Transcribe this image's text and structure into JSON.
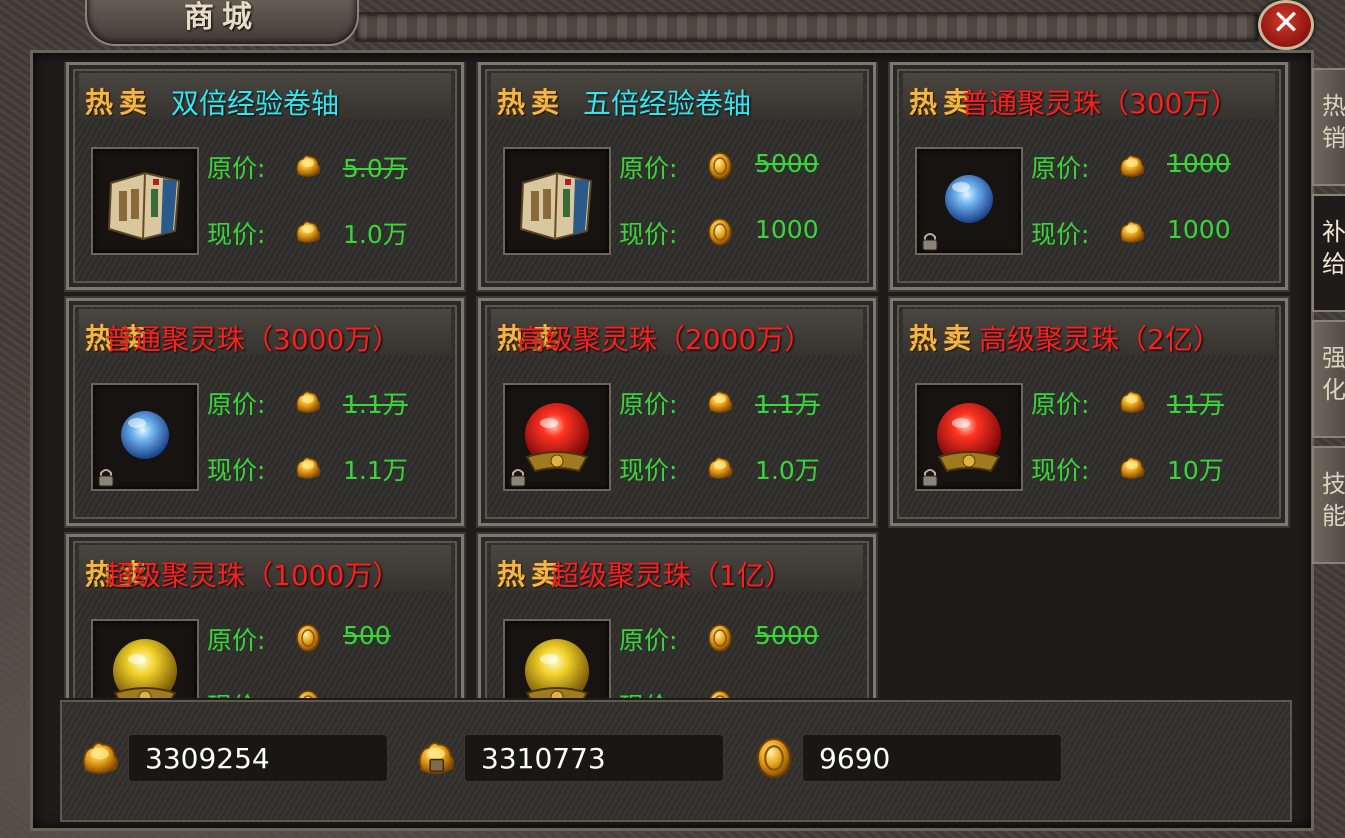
{
  "window": {
    "title": "商城",
    "close_label": "✕"
  },
  "side_tabs": [
    {
      "label": "热销",
      "active": false
    },
    {
      "label": "补给",
      "active": true
    },
    {
      "label": "强化",
      "active": false
    },
    {
      "label": "技能",
      "active": false
    }
  ],
  "labels": {
    "hot": "热卖",
    "original_price": "原价:",
    "current_price": "现价:"
  },
  "items": [
    {
      "name": "双倍经验卷轴",
      "name_color": "cyan",
      "icon": "scroll-book",
      "currency": "gold-ingot",
      "original": "5.0万",
      "current": "1.0万",
      "locked": false
    },
    {
      "name": "五倍经验卷轴",
      "name_color": "cyan",
      "icon": "scroll-book",
      "currency": "gold-coin",
      "original": "5000",
      "current": "1000",
      "locked": false
    },
    {
      "name": "普通聚灵珠（300万）",
      "name_color": "red",
      "icon": "blue-orb",
      "currency": "gold-ingot",
      "original": "1000",
      "current": "1000",
      "locked": true
    },
    {
      "name": "普通聚灵珠（3000万）",
      "name_color": "red",
      "icon": "blue-orb",
      "currency": "gold-ingot",
      "original": "1.1万",
      "current": "1.1万",
      "locked": true
    },
    {
      "name": "高级聚灵珠（2000万）",
      "name_color": "red",
      "icon": "red-orb",
      "currency": "gold-ingot",
      "original": "1.1万",
      "current": "1.0万",
      "locked": true
    },
    {
      "name": "高级聚灵珠（2亿）",
      "name_color": "red",
      "icon": "red-orb",
      "currency": "gold-ingot",
      "original": "11万",
      "current": "10万",
      "locked": true
    },
    {
      "name": "超级聚灵珠（1000万）",
      "name_color": "red",
      "icon": "yellow-orb",
      "currency": "gold-coin",
      "original": "500",
      "current": "",
      "locked": true
    },
    {
      "name": "超级聚灵珠（1亿）",
      "name_color": "red",
      "icon": "yellow-orb",
      "currency": "gold-coin",
      "original": "5000",
      "current": "",
      "locked": true
    }
  ],
  "currencies": [
    {
      "icon": "gold-ingot",
      "value": "3309254"
    },
    {
      "icon": "gold-ingot-bound",
      "value": "3310773"
    },
    {
      "icon": "gold-coin",
      "value": "9690"
    }
  ],
  "colors": {
    "price_green": "#38d638",
    "name_cyan": "#34e6f0",
    "name_red": "#ff1e1e",
    "hot_gold": "#f0b64a"
  }
}
